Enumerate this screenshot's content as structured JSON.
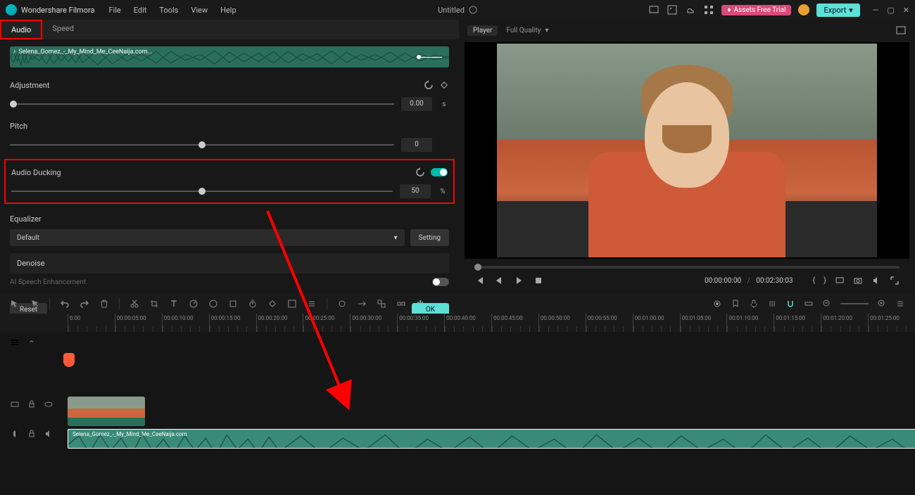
{
  "app": {
    "name": "Wondershare Filmora",
    "title": "Untitled"
  },
  "menu": [
    "File",
    "Edit",
    "Tools",
    "View",
    "Help"
  ],
  "topright": {
    "trial": "Assets Free Trial",
    "export": "Export"
  },
  "tabs": {
    "audio": "Audio",
    "speed": "Speed"
  },
  "waveform_file": "Selena_Gomez_-_My_Mind_Me_CeeNaija.com...",
  "adjustment": {
    "label": "Adjustment",
    "value": "0.00",
    "unit": "s"
  },
  "pitch": {
    "label": "Pitch",
    "value": "0"
  },
  "ducking": {
    "label": "Audio Ducking",
    "value": "50",
    "unit": "%"
  },
  "equalizer": {
    "label": "Equalizer",
    "preset": "Default",
    "setting": "Setting"
  },
  "denoise": {
    "label": "Denoise"
  },
  "ai": {
    "label": "AI Speech Enhancement"
  },
  "buttons": {
    "reset": "Reset",
    "ok": "OK"
  },
  "player": {
    "label": "Player",
    "quality": "Full Quality",
    "time_cur": "00:00:00:00",
    "time_tot": "00:02:30:03"
  },
  "ruler": [
    "0:00",
    "00:00:05:00",
    "00:00:10:00",
    "00:00:15:00",
    "00:00:20:00",
    "00:00:25:00",
    "00:00:30:00",
    "00:00:35:00",
    "00:00:40:00",
    "00:00:45:00",
    "00:00:50:00",
    "00:00:55:00",
    "00:01:00:00",
    "00:01:05:00",
    "00:01:10:00",
    "00:01:15:00",
    "00:01:20:00",
    "00:01:25:00"
  ],
  "audio_clip_label": "Selena_Gomez_-_My_Mind_Me_CeeNaija.com"
}
